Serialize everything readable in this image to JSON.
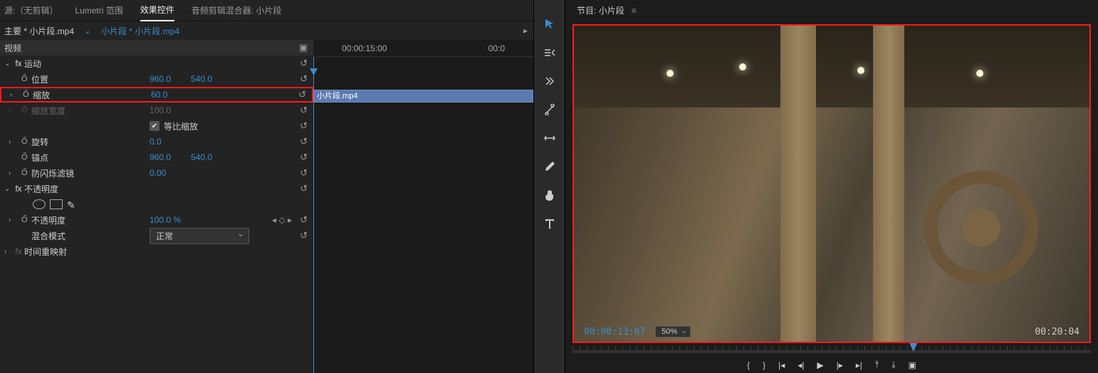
{
  "tabs": {
    "source": "源:（无剪辑）",
    "lumetri": "Lumetri 范围",
    "effect_controls": "效果控件",
    "audio_mixer_prefix": "音频剪辑混合器:",
    "audio_mixer_clip": "小片段"
  },
  "source_bar": {
    "master_label": "主要 * 小片段.mp4",
    "link": "小片段 * 小片段.mp4"
  },
  "timeline": {
    "start": "00:00:15:00",
    "end": "00:0",
    "clip_name": "小片段.mp4"
  },
  "effects": {
    "video_header": "视频",
    "motion": {
      "label": "运动",
      "position_label": "位置",
      "position_x": "960.0",
      "position_y": "540.0",
      "scale_label": "缩放",
      "scale_value": "60.0",
      "scale_width_label": "缩放宽度",
      "scale_width_value": "100.0",
      "uniform_label": "等比缩放",
      "uniform_checked": true,
      "rotation_label": "旋转",
      "rotation_value": "0.0",
      "anchor_label": "锚点",
      "anchor_x": "960.0",
      "anchor_y": "540.0",
      "flicker_label": "防闪烁滤镜",
      "flicker_value": "0.00"
    },
    "opacity": {
      "label": "不透明度",
      "opacity_label": "不透明度",
      "opacity_value": "100.0 %",
      "blend_label": "混合模式",
      "blend_value": "正常"
    },
    "time_remap_label": "时间重映射"
  },
  "program": {
    "tab_prefix": "节目:",
    "tab_clip": "小片段",
    "current_tc": "00:00:13:07",
    "zoom": "50%",
    "duration_tc": "00:20:04"
  },
  "icons": {
    "stopwatch": "Ő",
    "reset": "↺",
    "keyframe_nav": "◇"
  }
}
